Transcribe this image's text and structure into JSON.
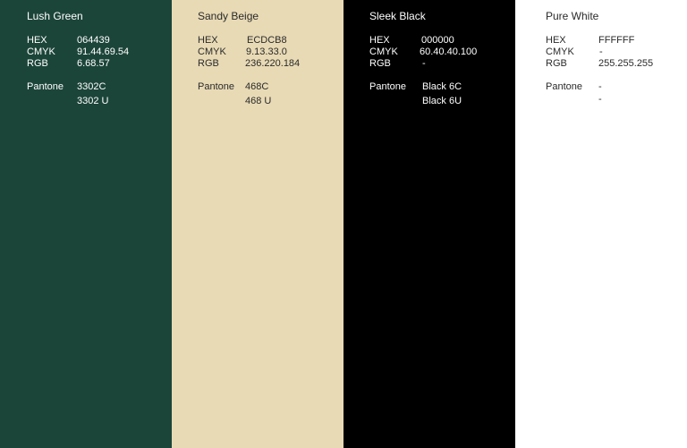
{
  "swatches": [
    {
      "name": "Lush Green",
      "bg": "#1C4539",
      "fg": "#FFFFFF",
      "hex_label": "HEX",
      "hex": "064439",
      "cmyk_label": "CMYK",
      "cmyk": "91.44.69.54",
      "rgb_label": "RGB",
      "rgb": "6.68.57",
      "pantone_label": "Pantone",
      "pantone_1": "3302C",
      "pantone_2": "3302 U"
    },
    {
      "name": "Sandy Beige",
      "bg": "#E8DAB5",
      "fg": "#2A2A2A",
      "hex_label": "HEX",
      "hex": "ECDCB8",
      "cmyk_label": "CMYK",
      "cmyk": "9.13.33.0",
      "rgb_label": "RGB",
      "rgb": "236.220.184",
      "pantone_label": "Pantone",
      "pantone_1": "468C",
      "pantone_2": "468 U"
    },
    {
      "name": "Sleek Black",
      "bg": "#000000",
      "fg": "#FFFFFF",
      "hex_label": "HEX",
      "hex": "000000",
      "cmyk_label": "CMYK",
      "cmyk": "60.40.40.100",
      "rgb_label": "RGB",
      "rgb": "-",
      "pantone_label": "Pantone",
      "pantone_1": "Black 6C",
      "pantone_2": "Black 6U"
    },
    {
      "name": "Pure White",
      "bg": "#FFFFFF",
      "fg": "#2A2A2A",
      "hex_label": "HEX",
      "hex": "FFFFFF",
      "cmyk_label": "CMYK",
      "cmyk": "-",
      "rgb_label": "RGB",
      "rgb": "255.255.255",
      "pantone_label": "Pantone",
      "pantone_1": "-",
      "pantone_2": "-"
    }
  ]
}
